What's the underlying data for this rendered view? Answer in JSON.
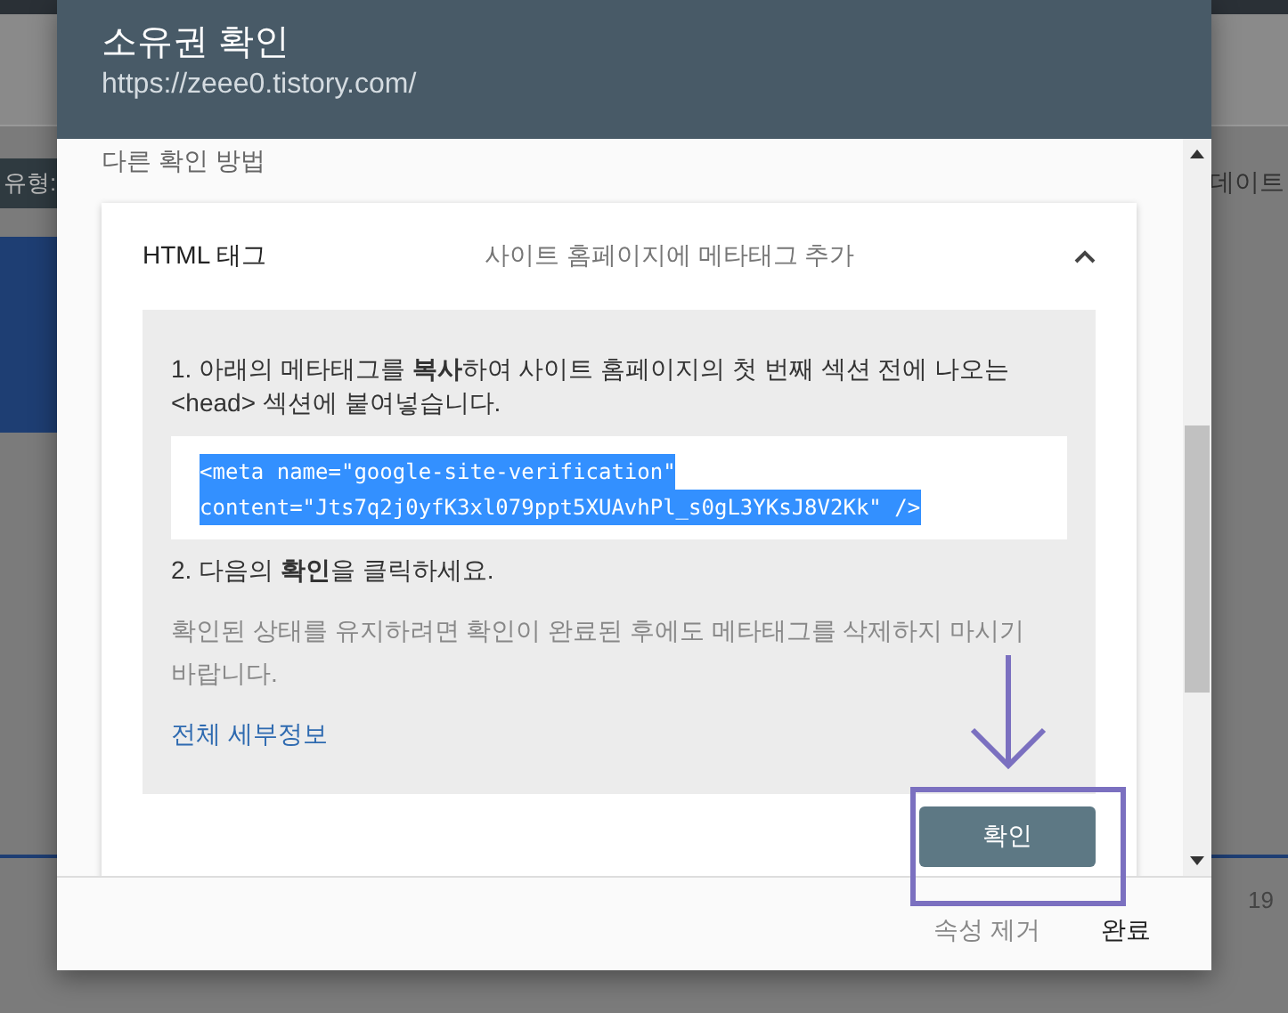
{
  "background": {
    "label_left": "유형:",
    "label_right": "데이트",
    "axis_label": "19"
  },
  "dialog": {
    "title": "소유권 확인",
    "subtitle": "https://zeee0.tistory.com/",
    "section_label": "다른 확인 방법",
    "method": {
      "name": "HTML 태그",
      "description": "사이트 홈페이지에 메타태그 추가",
      "expanded": true,
      "steps": [
        "1. 아래의 메타태그를 **복사**하여 사이트 홈페이지의 첫 번째 섹션 전에 나오는 <head> 섹션에 붙여넣습니다.",
        "2. 다음의 **확인**을 클릭하세요."
      ],
      "code_lines": [
        "<meta name=\"google-site-verification\"",
        "content=\"Jts7q2j0yfK3xl079ppt5XUAvhPl_s0gL3YKsJ8V2Kk\" />"
      ],
      "code_selected": true,
      "note": "확인된 상태를 유지하려면 확인이 완료된 후에도 메타태그를 삭제하지 마시기 바랍니다.",
      "link": "전체 세부정보",
      "verify_button": "확인"
    },
    "footer_buttons": [
      {
        "label": "속성 제거",
        "kind": "secondary"
      },
      {
        "label": "완료",
        "kind": "primary"
      }
    ]
  }
}
